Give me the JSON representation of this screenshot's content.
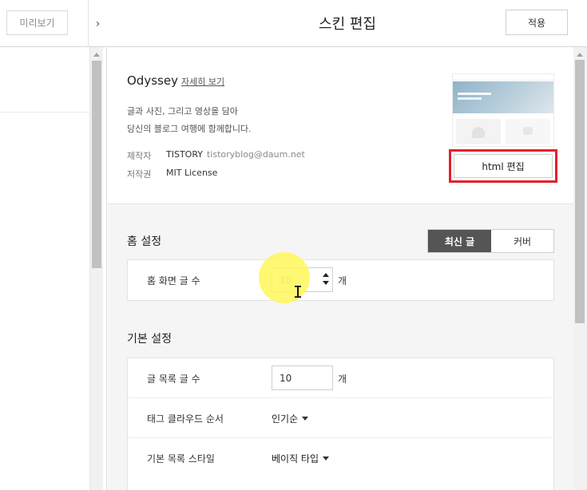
{
  "left_pane": {
    "preview_label": "미리보기",
    "collapse_glyph": "›"
  },
  "header": {
    "title": "스킨 편집",
    "apply_label": "적용"
  },
  "skin": {
    "name": "Odyssey",
    "detail_link": "자세히 보기",
    "description_line1": "글과 사진, 그리고 영상을 담아",
    "description_line2": "당신의 블로그 여행에 함께합니다.",
    "maker_label": "제작자",
    "maker_value": "TISTORY",
    "maker_email": "tistoryblog@daum.net",
    "license_label": "저작권",
    "license_value": "MIT License",
    "html_edit_label": "html 편집",
    "html_edit_highlight_color": "#e5202a"
  },
  "home_settings": {
    "title": "홈 설정",
    "toggle_options": [
      "최신 글",
      "커버"
    ],
    "toggle_selected": "최신 글",
    "row_label": "홈 화면 글 수",
    "row_value": "10",
    "row_unit": "개"
  },
  "basic_settings": {
    "title": "기본 설정",
    "post_count_label": "글 목록 글 수",
    "post_count_value": "10",
    "post_count_unit": "개",
    "tag_order_label": "태그 클라우드 순서",
    "tag_order_value": "인기순",
    "list_style_label": "기본 목록 스타일",
    "list_style_value": "베이직 타입"
  },
  "colors": {
    "toggle_active_bg": "#555555",
    "cursor_highlight": "#fff75a"
  }
}
